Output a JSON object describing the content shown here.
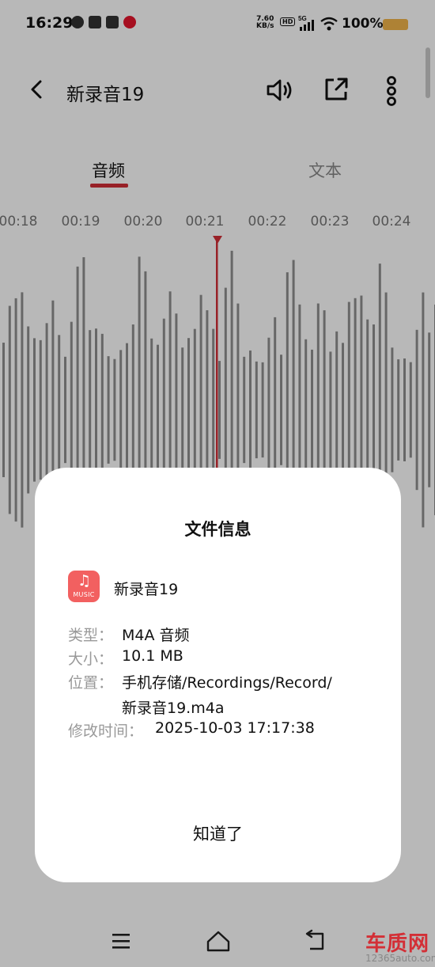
{
  "status_bar": {
    "time": "16:29",
    "net_speed_value": "7.60",
    "net_speed_unit": "KB/s",
    "hd": "HD",
    "signal": "5G",
    "battery": "100%",
    "icons": [
      "wechat-icon",
      "clipboard-icon",
      "game-icon",
      "weibo-icon",
      "hd-icon",
      "signal-icon",
      "wifi-icon",
      "battery-icon"
    ]
  },
  "header": {
    "title": "新录音19",
    "icons": [
      "back-icon",
      "speaker-icon",
      "share-icon",
      "more-icon"
    ]
  },
  "tabs": [
    {
      "label": "音频",
      "active": true
    },
    {
      "label": "文本",
      "active": false
    }
  ],
  "timeline": {
    "ticks": [
      "00:18",
      "00:19",
      "00:20",
      "00:21",
      "00:22",
      "00:23",
      "00:24"
    ]
  },
  "colors": {
    "accent": "#d32f36",
    "waveform": "#8f8f8f",
    "music_icon": "#f26060"
  },
  "dialog": {
    "title": "文件信息",
    "file_name": "新录音19",
    "music_icon_label": "MUSIC",
    "type_label": "类型：",
    "type_value": "M4A 音频",
    "size_label": "大小：",
    "size_value": "10.1 MB",
    "location_label": "位置：",
    "location_value_line1": "手机存储/Recordings/Record/",
    "location_value_line2": "新录音19.m4a",
    "modified_label": "修改时间：",
    "modified_value": "2025-10-03 17:17:38",
    "ok_label": "知道了"
  },
  "watermark": {
    "url": "www.12365auto.com",
    "logo": "车质网",
    "logo_url": "12365auto.com"
  }
}
